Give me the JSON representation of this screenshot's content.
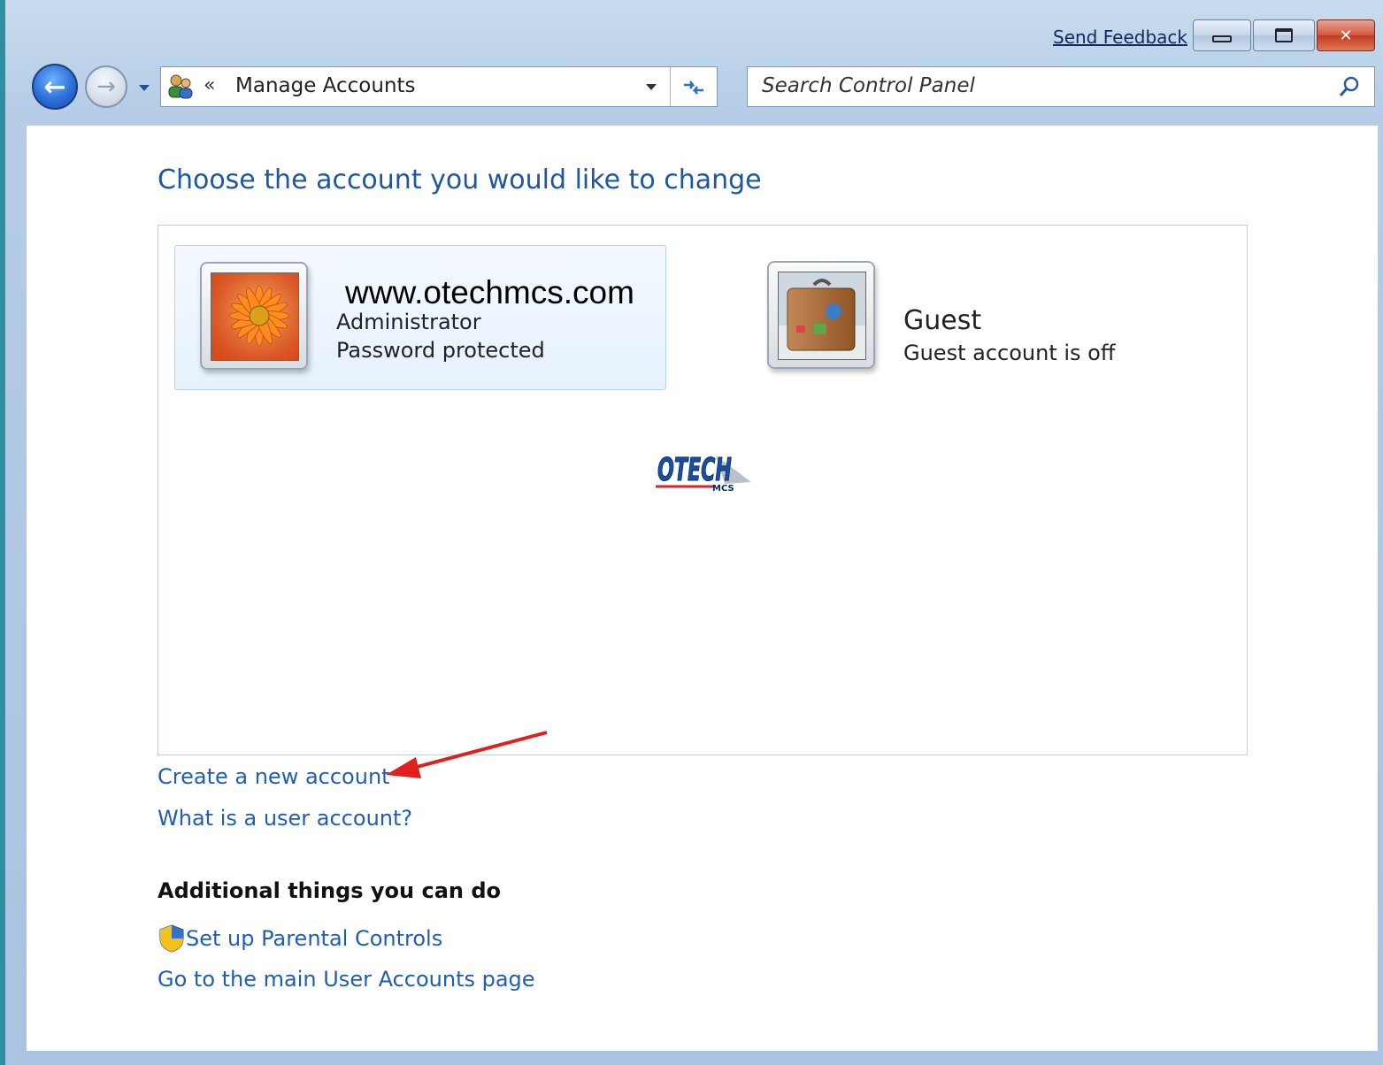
{
  "titlebar": {
    "feedback_label": "Send Feedback"
  },
  "address": {
    "chevron": "«",
    "path": "Manage Accounts"
  },
  "search": {
    "placeholder": "Search Control Panel"
  },
  "main": {
    "heading": "Choose the account you would like to change",
    "watermark": "www.otechmcs.com",
    "logo_text": "OTECH",
    "logo_sub": "MCS",
    "accounts": [
      {
        "name": "Administrator",
        "status": "Password protected"
      },
      {
        "name": "Guest",
        "status": "Guest account is off"
      }
    ],
    "links": {
      "create": "Create a new account",
      "what_is": "What is a user account?"
    },
    "additional": {
      "heading": "Additional things you can do",
      "parental": "Set up Parental Controls",
      "main_page": "Go to the main User Accounts page"
    }
  },
  "colors": {
    "link": "#1f5eb4",
    "heading": "#1e56a0",
    "annotation_arrow": "#e0201c"
  }
}
